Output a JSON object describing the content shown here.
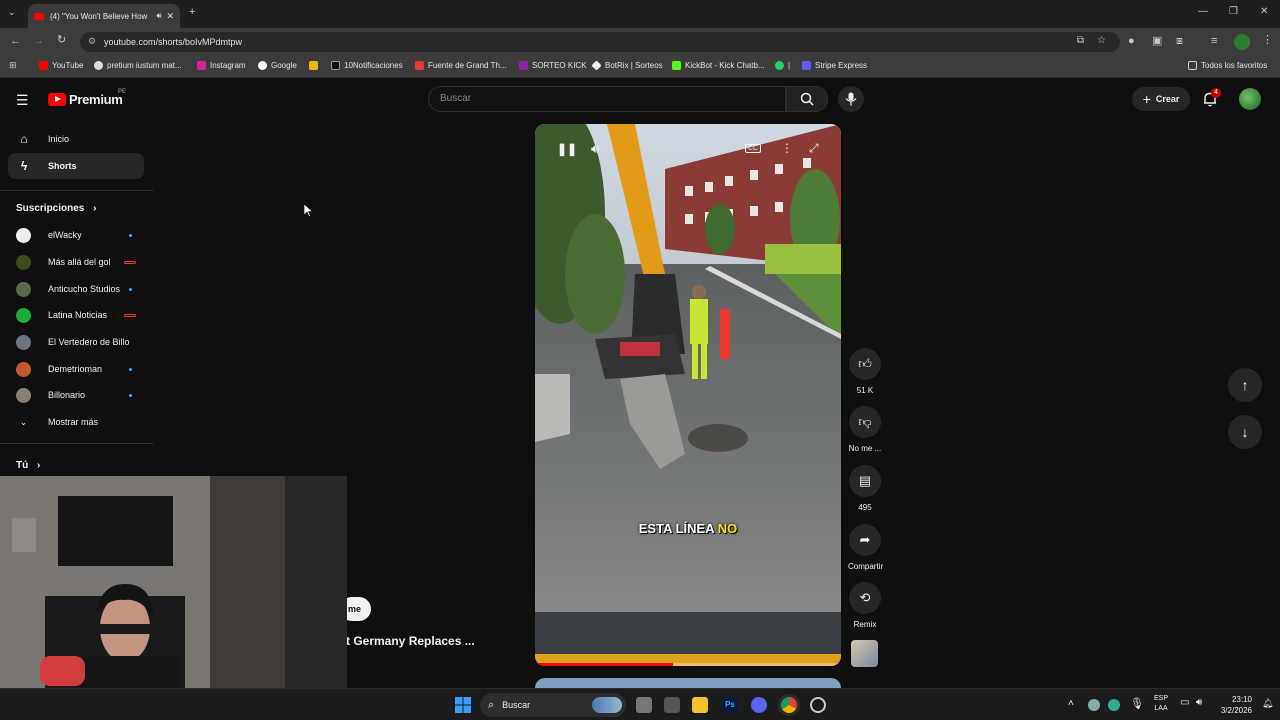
{
  "browser": {
    "tab_title": "(4) \"You Won't Believe How",
    "url": "youtube.com/shorts/boIvMPdmtpw",
    "bookmarks": [
      "YouTube",
      "pretium iustum mat...",
      "Instagram",
      "Google",
      "10Notificaciones",
      "Fuente de Grand Th...",
      "SORTEO KICK",
      "BotRix | Sorteos",
      "KickBot - Kick Chatb...",
      "|",
      "Stripe Express"
    ],
    "all_bookmarks": "Todos los favoritos"
  },
  "header": {
    "logo_text": "Premium",
    "logo_region": "PE",
    "search_placeholder": "Buscar",
    "create_label": "Crear",
    "notif_count": "4"
  },
  "sidebar": {
    "nav": [
      {
        "label": "Inicio",
        "icon": "home-icon"
      },
      {
        "label": "Shorts",
        "icon": "shorts-icon"
      }
    ],
    "subscriptions_title": "Suscripciones",
    "subscriptions": [
      {
        "name": "elWacky",
        "status": "dot"
      },
      {
        "name": "Más allá del gol",
        "status": "live"
      },
      {
        "name": "Anticucho Studios",
        "status": "dot"
      },
      {
        "name": "Latina Noticias",
        "status": "live"
      },
      {
        "name": "El Vertedero de Billo",
        "status": ""
      },
      {
        "name": "Demetrioman",
        "status": "dot"
      },
      {
        "name": "Billonario",
        "status": "dot"
      }
    ],
    "show_more": "Mostrar más",
    "you_title": "Tú"
  },
  "short": {
    "caption": "ESTA LÍNEA",
    "caption_highlight": "NO",
    "partial_title": "t Germany Replaces ...",
    "partial_chip": "me",
    "likes": "51 K",
    "dislike_label": "No me ...",
    "comments": "495",
    "share_label": "Compartir",
    "remix_label": "Remix"
  },
  "taskbar": {
    "search": "Buscar",
    "lang_top": "ESP",
    "lang_bottom": "LAA",
    "time": "23:10",
    "date": "3/2/2026"
  }
}
